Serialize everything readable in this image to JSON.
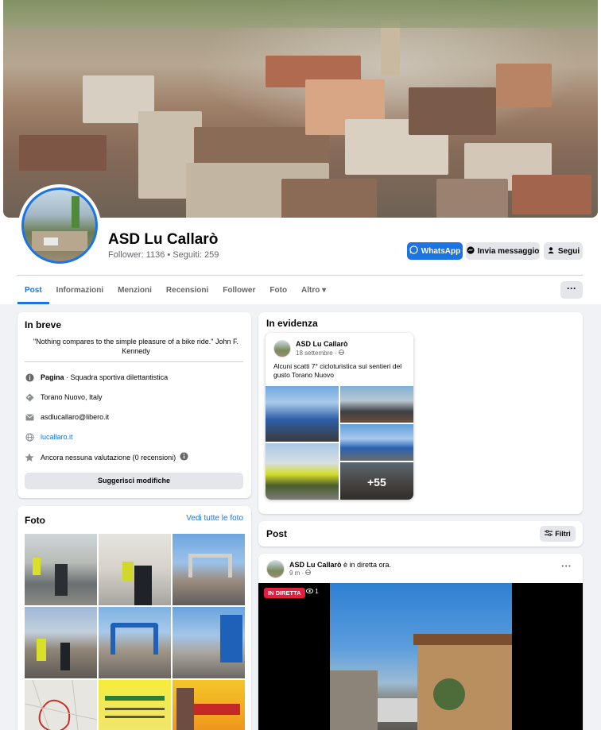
{
  "page": {
    "name": "ASD Lu Callarò",
    "follower_text": "Follower: 1136",
    "sep": " • ",
    "following_text": "Seguiti: 259"
  },
  "actions": {
    "whatsapp": "WhatsApp",
    "message": "Invia messaggio",
    "follow": "Segui"
  },
  "tabs": [
    "Post",
    "Informazioni",
    "Menzioni",
    "Recensioni",
    "Follower",
    "Foto",
    "Altro ▾"
  ],
  "more": "···",
  "intro": {
    "title": "In breve",
    "quote": "\"Nothing compares to the simple pleasure of a bike ride.\" John F. Kennedy",
    "category_label": "Pagina",
    "category_value": " · Squadra sportiva dilettantistica",
    "location": "Torano Nuovo, Italy",
    "email": "asdlucallaro@libero.it",
    "website": "lucallaro.it",
    "rating": "Ancora nessuna valutazione (0 recensioni)",
    "suggest": "Suggerisci modifiche"
  },
  "photos": {
    "title": "Foto",
    "see_all": "Vedi tutte le foto"
  },
  "featured": {
    "title": "In evidenza",
    "author": "ASD Lu Callarò",
    "date": "18 settembre · ",
    "text": "Alcuni scatti 7° cicloturistica sui sentieri del gusto Torano Nuovo",
    "more_count": "+55"
  },
  "posts": {
    "title": "Post",
    "filter": "Filtri"
  },
  "live_post": {
    "author": "ASD Lu Callarò",
    "status": " è in diretta ora.",
    "time": "9 m · ",
    "badge": "IN DIRETTA",
    "viewers": "1"
  },
  "colors": {
    "accent": "#1b74e4",
    "live": "#e41e3f",
    "background": "#f0f2f5"
  }
}
